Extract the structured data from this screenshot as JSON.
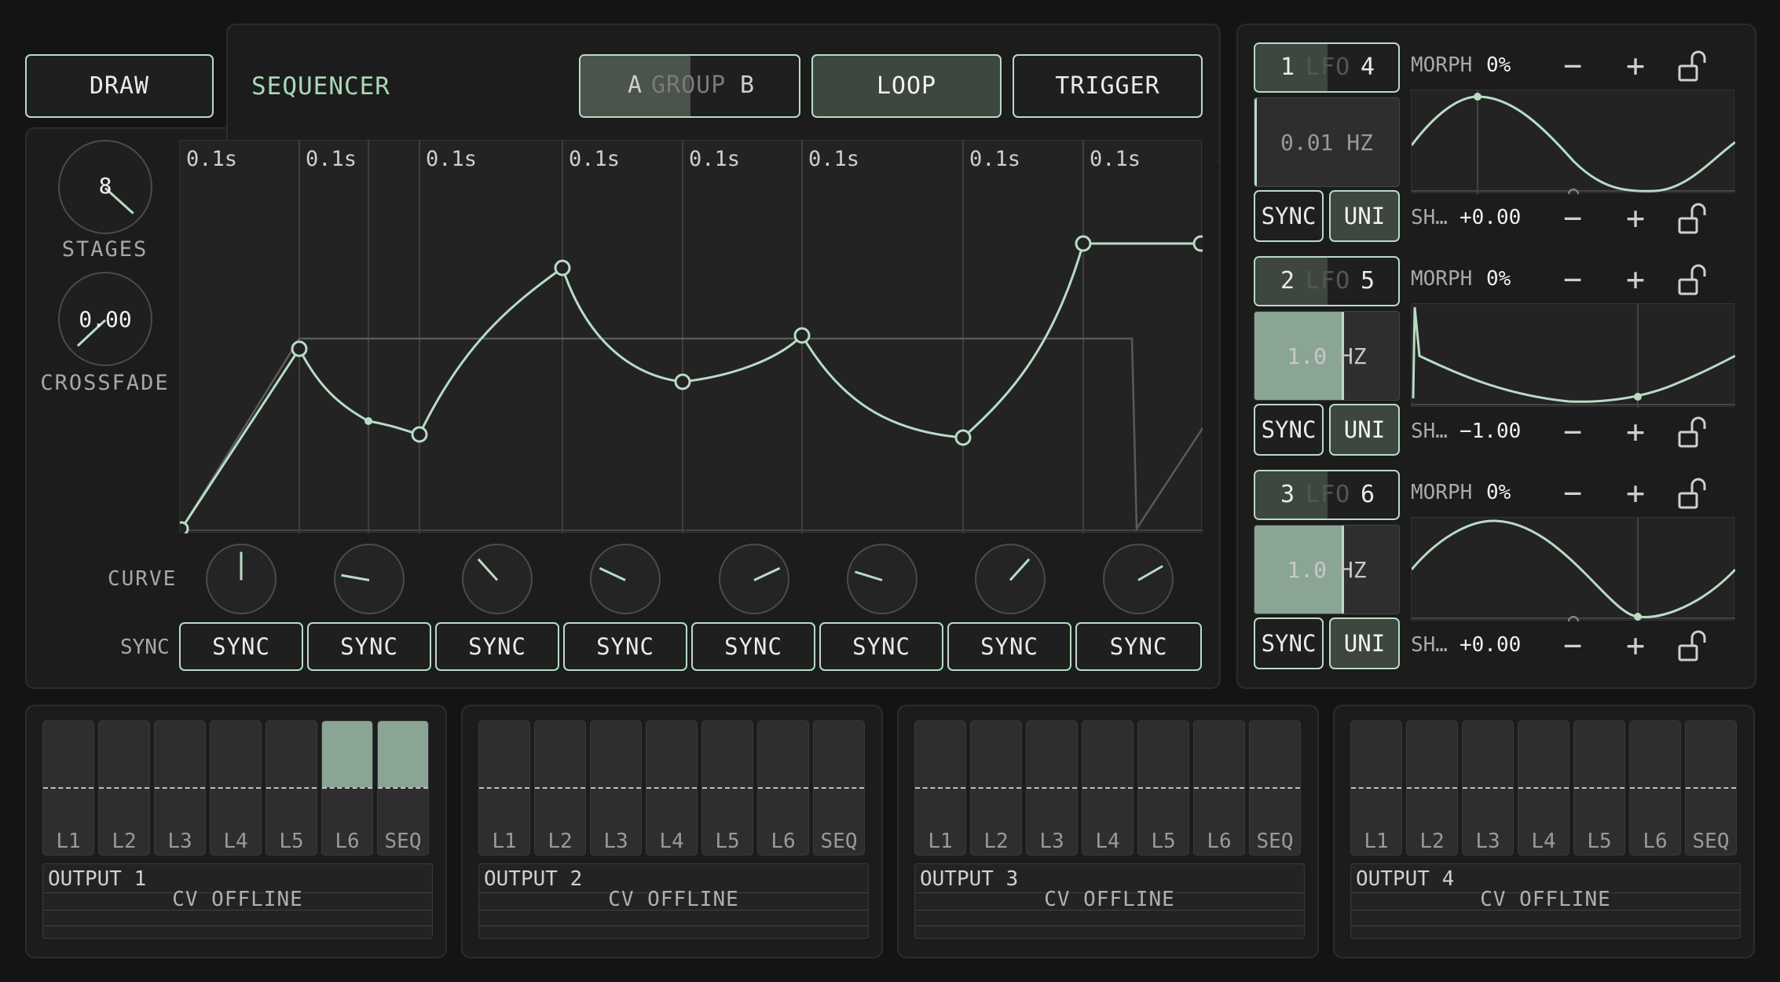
{
  "colors": {
    "accent": "#b8dcc4",
    "bg": "#141414",
    "panel": "#1c1c1c"
  },
  "toolbar": {
    "draw_label": "DRAW",
    "sequencer_label": "SEQUENCER",
    "group_a": "A",
    "group_mid": "GROUP",
    "group_b": "B",
    "loop_label": "LOOP",
    "trigger_label": "TRIGGER"
  },
  "left_knobs": {
    "stages_value": "8",
    "stages_label": "STAGES",
    "crossfade_value": "0.00",
    "crossfade_label": "CROSSFADE"
  },
  "sequencer": {
    "step_times": [
      "0.1s",
      "0.1s",
      "0.1s",
      "0.1s",
      "0.1s",
      "0.1s",
      "0.1s",
      "0.1s"
    ],
    "curve_label": "CURVE",
    "sync_label": "SYNC",
    "sync_buttons": [
      "SYNC",
      "SYNC",
      "SYNC",
      "SYNC",
      "SYNC",
      "SYNC",
      "SYNC",
      "SYNC"
    ]
  },
  "lfos": [
    {
      "num_a": "1",
      "mid": "LFO",
      "num_b": "4",
      "rate": "0.01 HZ",
      "rate_level": 0.0,
      "sync": "SYNC",
      "uni": "UNI",
      "morph_label": "MORPH",
      "morph_value": "0%",
      "shape_label": "SH…",
      "shape_value": "+0.00",
      "minus": "−",
      "plus": "+"
    },
    {
      "num_a": "2",
      "mid": "LFO",
      "num_b": "5",
      "rate": "1.0 HZ",
      "rate_level": 0.62,
      "sync": "SYNC",
      "uni": "UNI",
      "morph_label": "MORPH",
      "morph_value": "0%",
      "shape_label": "SH…",
      "shape_value": "−1.00",
      "minus": "−",
      "plus": "+"
    },
    {
      "num_a": "3",
      "mid": "LFO",
      "num_b": "6",
      "rate": "1.0 HZ",
      "rate_level": 0.62,
      "sync": "SYNC",
      "uni": "UNI",
      "morph_label": "MORPH",
      "morph_value": "0%",
      "shape_label": "SH…",
      "shape_value": "+0.00",
      "minus": "−",
      "plus": "+"
    }
  ],
  "outputs": [
    {
      "title": "OUTPUT 1",
      "status": "CV OFFLINE",
      "faders": [
        "L1",
        "L2",
        "L3",
        "L4",
        "L5",
        "L6",
        "SEQ"
      ],
      "levels": [
        0,
        0,
        0,
        0,
        0,
        0.5,
        0.5
      ]
    },
    {
      "title": "OUTPUT 2",
      "status": "CV OFFLINE",
      "faders": [
        "L1",
        "L2",
        "L3",
        "L4",
        "L5",
        "L6",
        "SEQ"
      ],
      "levels": [
        0,
        0,
        0,
        0,
        0,
        0,
        0
      ]
    },
    {
      "title": "OUTPUT 3",
      "status": "CV OFFLINE",
      "faders": [
        "L1",
        "L2",
        "L3",
        "L4",
        "L5",
        "L6",
        "SEQ"
      ],
      "levels": [
        0,
        0,
        0,
        0,
        0,
        0,
        0
      ]
    },
    {
      "title": "OUTPUT 4",
      "status": "CV OFFLINE",
      "faders": [
        "L1",
        "L2",
        "L3",
        "L4",
        "L5",
        "L6",
        "SEQ"
      ],
      "levels": [
        0,
        0,
        0,
        0,
        0,
        0,
        0
      ]
    }
  ]
}
